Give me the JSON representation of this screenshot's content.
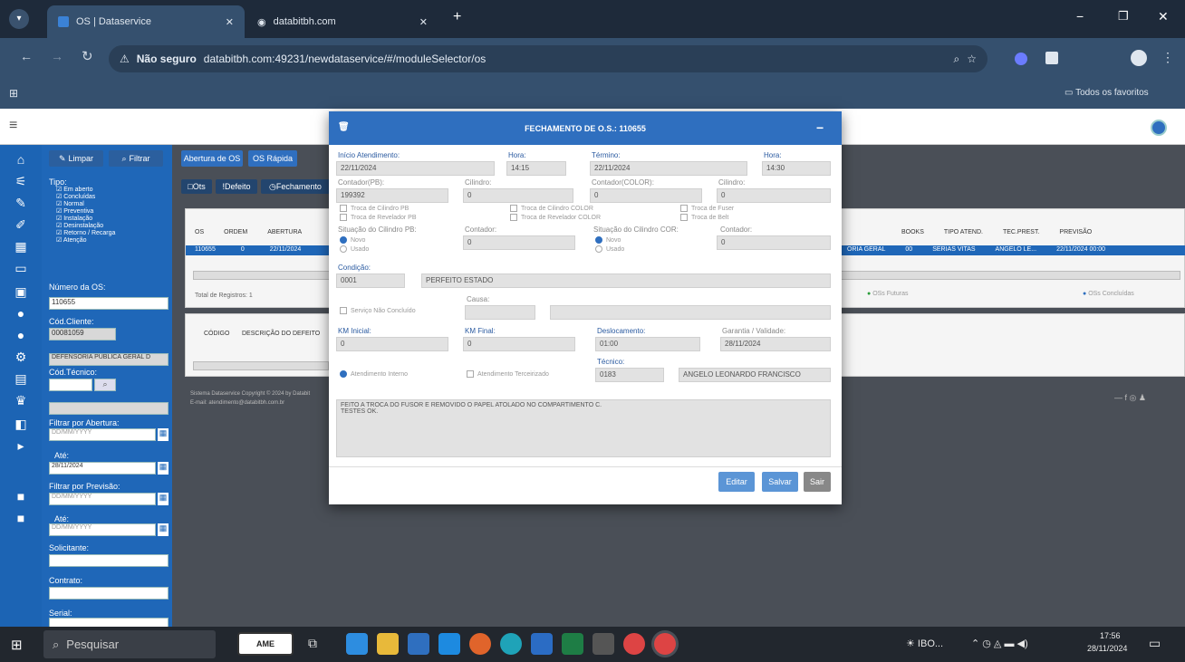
{
  "browser": {
    "tabs": [
      {
        "label": "OS | Dataservice"
      },
      {
        "label": "databitbh.com"
      }
    ],
    "address": {
      "security": "Não seguro",
      "url": "databitbh.com:49231/newdataservice/#/moduleSelector/os"
    },
    "bookmarks_folder": "Todos os favoritos"
  },
  "sidebar": {
    "clear_label": "Limpar",
    "filter_label": "Filtrar",
    "tipo_label": "Tipo:",
    "tipo_options": [
      "Em aberto",
      "Concluídas",
      "Normal",
      "Preventiva",
      "Instalação",
      "Desinstalação",
      "Retorno / Recarga",
      "Atenção"
    ],
    "os_number_label": "Número da OS:",
    "os_number_value": "110655",
    "client_code_label": "Cód.Cliente:",
    "client_code_value": "00081059",
    "client_name_value": "DEFENSORIA PUBLICA GERAL D",
    "tech_code_label": "Cód.Técnico:",
    "filter_open_label": "Filtrar por Abertura:",
    "date_placeholder": "DD/MM/YYYY",
    "ate_label": "Até:",
    "ate_value": "28/11/2024",
    "filter_forecast_label": "Filtrar por Previsão:",
    "solicitante_label": "Solicitante:",
    "contrato_label": "Contrato:",
    "serial_label": "Serial:"
  },
  "content": {
    "btn_abertura": "Abertura de OS",
    "btn_rapida": "OS Rápida",
    "btn_ots": "Ots",
    "btn_defeito": "Defeito",
    "btn_fechamento": "Fechamento",
    "table_headers_left": [
      "OS",
      "ORDEM",
      "ABERTURA"
    ],
    "table_row_left": [
      "110655",
      "0",
      "22/11/2024"
    ],
    "table_headers_right": [
      "BOOKS",
      "TIPO ATEND.",
      "TEC.PREST.",
      "PREVISÃO"
    ],
    "table_row_right": [
      "ORIA GERAL",
      "00",
      "SERIAS VITAS",
      "ANGELO LE...",
      "22/11/2024 00:00"
    ],
    "total_label": "Total de Registros: 1",
    "legend_future": "OSs Futuras",
    "legend_done": "OSs Concluídas",
    "detail_headers": [
      "CÓDIGO",
      "DESCRIÇÃO DO DEFEITO"
    ],
    "footer_text": "Sistema Dataservice Copyright © 2024 by Databit",
    "footer_email": "E-mail: atendimento@databitbh.com.br"
  },
  "modal": {
    "title": "FECHAMENTO DE O.S.: 110655",
    "inicio_label": "Início Atendimento:",
    "inicio_value": "22/11/2024",
    "hora1_label": "Hora:",
    "hora1_value": "14:15",
    "termino_label": "Término:",
    "termino_value": "22/11/2024",
    "hora2_label": "Hora:",
    "hora2_value": "14:30",
    "contador_pb_label": "Contador(PB):",
    "contador_pb_value": "199392",
    "cilindro1_label": "Cilindro:",
    "cilindro1_value": "0",
    "contador_color_label": "Contador(COLOR):",
    "contador_color_value": "0",
    "cilindro2_label": "Cilindro:",
    "cilindro2_value": "0",
    "troca_cil_pb": "Troca de Cilindro PB",
    "troca_rev_pb": "Troca de Revelador PB",
    "troca_cil_color": "Troca de Cilindro COLOR",
    "troca_rev_color": "Troca de Revelador COLOR",
    "troca_fuser": "Troca de Fuser",
    "troca_belt": "Troca de Belt",
    "sit_pb_label": "Situação do Cilindro PB:",
    "sit_color_label": "Situação do Cilindro COR:",
    "radio_novo": "Novo",
    "radio_usado": "Usado",
    "contador2_label": "Contador:",
    "contador2_value": "0",
    "contador3_label": "Contador:",
    "contador3_value": "0",
    "condicao_label": "Condição:",
    "condicao_code": "0001",
    "condicao_desc": "PERFEITO ESTADO",
    "causa_label": "Causa:",
    "servico_label": "Serviço Não Concluído",
    "km_inicial_label": "KM Inicial:",
    "km_inicial_value": "0",
    "km_final_label": "KM Final:",
    "km_final_value": "0",
    "desloc_label": "Deslocamento:",
    "desloc_value": "01:00",
    "garantia_label": "Garantia / Validade:",
    "garantia_value": "28/11/2024",
    "tecnico_label": "Técnico:",
    "atend_interno": "Atendimento Interno",
    "atend_terceirizado": "Atendimento Terceirizado",
    "tecnico_code": "0183",
    "tecnico_name": "ANGELO LEONARDO FRANCISCO",
    "obs_text": "FEITO A TROCA DO FUSOR E REMOVIDO O PAPEL ATOLADO NO COMPARTIMENTO C.\nTESTES OK.",
    "btn_editar": "Editar",
    "btn_salvar": "Salvar",
    "btn_sair": "Sair"
  },
  "taskbar": {
    "search_placeholder": "Pesquisar",
    "weather": "IBO...",
    "time": "17:56",
    "date": "28/11/2024"
  }
}
